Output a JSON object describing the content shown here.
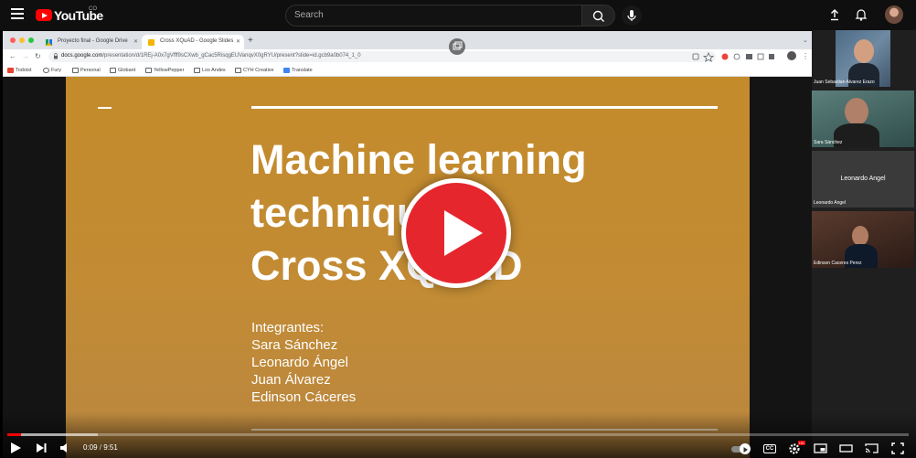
{
  "youtube": {
    "logo_text": "YouTube",
    "country_code": "CO",
    "search_placeholder": "Search"
  },
  "browser": {
    "tabs": [
      {
        "title": "Proyecto final - Google Drive",
        "favicon_color": "#1a73e8"
      },
      {
        "title": "Cross XQuAD - Google Slides",
        "favicon_color": "#f4b400"
      }
    ],
    "url_host": "docs.google.com",
    "url_rest": "/presentation/d/1REj-A0x7gVfff9sCXwb_gCac5RisqgEUVanqvX0gRYU/present?slide=id.gcb9a0b074_1_0",
    "bookmarks": [
      {
        "label": "Todoist",
        "icon_color": "#e44332"
      },
      {
        "label": "Fury",
        "icon_color": "#5f6368"
      },
      {
        "label": "Personal",
        "icon_color": "#5f6368"
      },
      {
        "label": "Globant",
        "icon_color": "#5f6368"
      },
      {
        "label": "YellowPepper",
        "icon_color": "#5f6368"
      },
      {
        "label": "Los Andes",
        "icon_color": "#5f6368"
      },
      {
        "label": "CYH Creative",
        "icon_color": "#5f6368"
      },
      {
        "label": "Translate",
        "icon_color": "#4285f4"
      }
    ]
  },
  "slide": {
    "title": "Machine learning\ntechniques\nCross XQuAD",
    "members_heading": "Integrantes:",
    "members": [
      "Sara Sánchez",
      "Leonardo Ángel",
      "Juan Álvarez",
      "Edinson Cáceres"
    ]
  },
  "participants": [
    {
      "name": "Juan Sebastian Alvarez Erazo"
    },
    {
      "name": "Sara Sánchez"
    },
    {
      "name": "Leonardo Angel",
      "center_label": "Leonardo Angel"
    },
    {
      "name": "Edinson Caceres Perez"
    }
  ],
  "player": {
    "current_time": "0:09",
    "duration": "9:51",
    "played_fraction": 0.015,
    "buffered_fraction": 0.1,
    "cc_label": "CC",
    "hd_label": "HD",
    "colors": {
      "accent": "#ff0000",
      "play_button": "#e6262d"
    }
  }
}
